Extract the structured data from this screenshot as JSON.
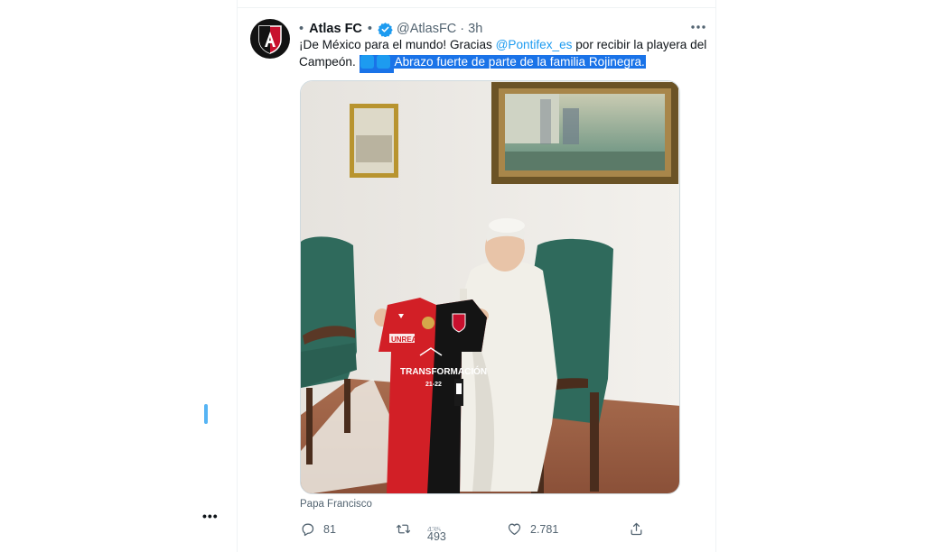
{
  "tweet": {
    "display_name": "Atlas FC",
    "handle": "@AtlasFC",
    "separator": "·",
    "time": "3h",
    "bullet": "•",
    "text_part1": "¡De México para el mundo! Gracias ",
    "mention": "@Pontifex_es",
    "text_part2": " por recibir la playera del Campeón. ",
    "highlighted_text": "Abrazo fuerte de parte de la familia Rojinegra.",
    "media_caption": "Papa Francisco",
    "jersey": {
      "sponsor": "UNREA",
      "slogan": "TRANSFORMACIÓN",
      "season": "21-22"
    }
  },
  "actions": {
    "replies": "81",
    "retweets": "493",
    "retweets_above": "435",
    "likes": "2.781"
  },
  "colors": {
    "accent": "#1d9bf0",
    "highlight": "#1a73e8",
    "atlas_red": "#c8102e",
    "atlas_black": "#121212"
  },
  "icons": {
    "avatar": "atlas-crest-icon",
    "verified": "verified-badge-icon",
    "more": "more-horizontal-icon",
    "reply": "reply-icon",
    "retweet": "retweet-icon",
    "like": "heart-icon",
    "share": "share-icon"
  }
}
